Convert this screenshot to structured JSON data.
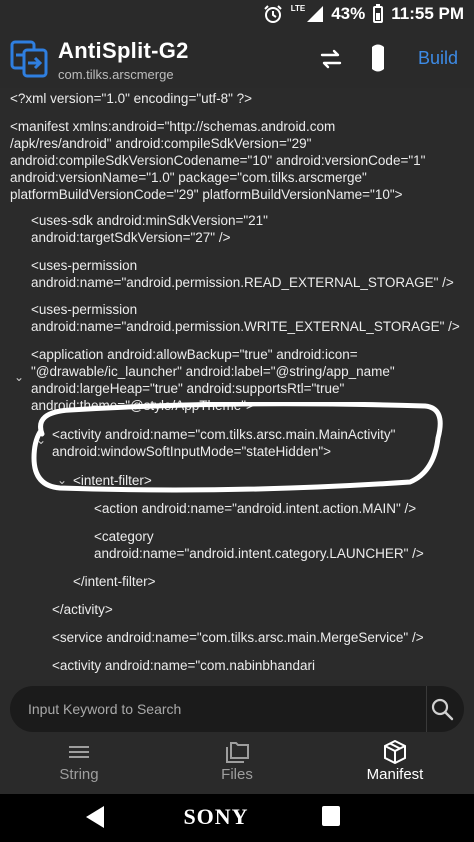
{
  "status_bar": {
    "network": "LTE",
    "battery": "43%",
    "time": "11:55 PM"
  },
  "app_bar": {
    "title": "AntiSplit-G2",
    "subtitle": "com.tilks.arscmerge",
    "build_label": "Build"
  },
  "code": {
    "lines": [
      "<?xml version=\"1.0\" encoding=\"utf-8\" ?>",
      "<manifest xmlns:android=\"http://schemas.android.com",
      "/apk/res/android\" android:compileSdkVersion=\"29\"",
      "android:compileSdkVersionCodename=\"10\" android:versionCode=\"1\"",
      "android:versionName=\"1.0\" package=\"com.tilks.arscmerge\"",
      "platformBuildVersionCode=\"29\" platformBuildVersionName=\"10\">",
      "<uses-sdk android:minSdkVersion=\"21\"",
      "android:targetSdkVersion=\"27\" />",
      "<uses-permission",
      "android:name=\"android.permission.READ_EXTERNAL_STORAGE\" />",
      "<uses-permission",
      "android:name=\"android.permission.WRITE_EXTERNAL_STORAGE\" />",
      "<application android:allowBackup=\"true\" android:icon=",
      "\"@drawable/ic_launcher\" android:label=\"@string/app_name\"",
      "android:largeHeap=\"true\" android:supportsRtl=\"true\"",
      "android:theme=\"@style/AppTheme\">",
      "<activity android:name=\"com.tilks.arsc.main.MainActivity\"",
      "android:windowSoftInputMode=\"stateHidden\">",
      "<intent-filter>",
      "<action android:name=\"android.intent.action.MAIN\" />",
      "<category",
      "android:name=\"android.intent.category.LAUNCHER\" />",
      "</intent-filter>",
      "</activity>",
      "<service android:name=\"com.tilks.arsc.main.MergeService\" />",
      "<activity android:name=\"com.nabinbhandari"
    ],
    "fold_marker": "⌄"
  },
  "search": {
    "placeholder": "Input Keyword to Search"
  },
  "tabs": [
    {
      "label": "String",
      "icon": "list-icon",
      "active": false
    },
    {
      "label": "Files",
      "icon": "folders-icon",
      "active": false
    },
    {
      "label": "Manifest",
      "icon": "package-icon",
      "active": true
    }
  ],
  "nav_bar": {
    "brand": "SONY"
  },
  "colors": {
    "background": "#2b2b2b",
    "accent": "#3d8be6",
    "annotation": "#ffffff"
  }
}
